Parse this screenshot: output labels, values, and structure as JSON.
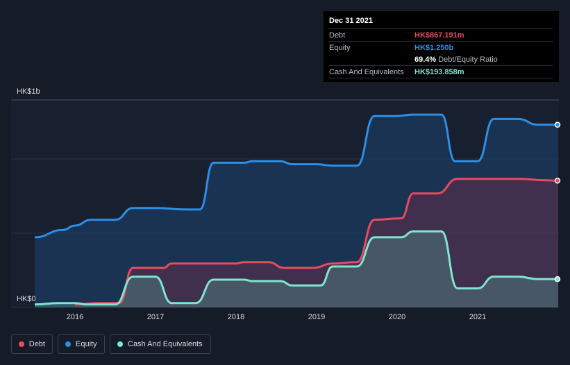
{
  "chart_data": {
    "type": "area",
    "y_axis": {
      "top_label": "HK$1b",
      "bottom_label": "HK$0",
      "ylim": [
        0,
        1.42
      ]
    },
    "x_ticks": [
      "2016",
      "2017",
      "2018",
      "2019",
      "2020",
      "2021"
    ],
    "series": [
      {
        "name": "Debt",
        "color": "#e84a5f",
        "points": [
          [
            2016.0,
            0.02
          ],
          [
            2016.3,
            0.03
          ],
          [
            2016.55,
            0.03
          ],
          [
            2016.72,
            0.27
          ],
          [
            2017.1,
            0.27
          ],
          [
            2017.2,
            0.3
          ],
          [
            2017.6,
            0.3
          ],
          [
            2018.0,
            0.3
          ],
          [
            2018.1,
            0.31
          ],
          [
            2018.4,
            0.31
          ],
          [
            2018.6,
            0.27
          ],
          [
            2018.95,
            0.27
          ],
          [
            2019.2,
            0.3
          ],
          [
            2019.5,
            0.31
          ],
          [
            2019.72,
            0.6
          ],
          [
            2020.05,
            0.61
          ],
          [
            2020.2,
            0.78
          ],
          [
            2020.5,
            0.78
          ],
          [
            2020.75,
            0.88
          ],
          [
            2021.2,
            0.88
          ],
          [
            2021.5,
            0.88
          ],
          [
            2021.85,
            0.87
          ],
          [
            2022.0,
            0.867
          ]
        ]
      },
      {
        "name": "Equity",
        "color": "#2d8ee6",
        "points": [
          [
            2015.5,
            0.48
          ],
          [
            2015.85,
            0.53
          ],
          [
            2016.0,
            0.56
          ],
          [
            2016.2,
            0.6
          ],
          [
            2016.5,
            0.6
          ],
          [
            2016.72,
            0.68
          ],
          [
            2017.0,
            0.68
          ],
          [
            2017.4,
            0.67
          ],
          [
            2017.55,
            0.67
          ],
          [
            2017.72,
            0.99
          ],
          [
            2018.1,
            0.99
          ],
          [
            2018.2,
            1.0
          ],
          [
            2018.55,
            1.0
          ],
          [
            2018.7,
            0.98
          ],
          [
            2019.0,
            0.98
          ],
          [
            2019.2,
            0.97
          ],
          [
            2019.5,
            0.97
          ],
          [
            2019.72,
            1.31
          ],
          [
            2020.0,
            1.31
          ],
          [
            2020.2,
            1.32
          ],
          [
            2020.55,
            1.32
          ],
          [
            2020.72,
            1.0
          ],
          [
            2021.0,
            1.0
          ],
          [
            2021.2,
            1.29
          ],
          [
            2021.5,
            1.29
          ],
          [
            2021.75,
            1.25
          ],
          [
            2022.0,
            1.25
          ]
        ]
      },
      {
        "name": "Cash And Equivalents",
        "color": "#7ee5d0",
        "points": [
          [
            2015.5,
            0.02
          ],
          [
            2015.8,
            0.03
          ],
          [
            2016.0,
            0.03
          ],
          [
            2016.15,
            0.02
          ],
          [
            2016.5,
            0.02
          ],
          [
            2016.72,
            0.21
          ],
          [
            2017.0,
            0.21
          ],
          [
            2017.2,
            0.03
          ],
          [
            2017.5,
            0.03
          ],
          [
            2017.72,
            0.19
          ],
          [
            2018.1,
            0.19
          ],
          [
            2018.2,
            0.18
          ],
          [
            2018.55,
            0.18
          ],
          [
            2018.7,
            0.15
          ],
          [
            2019.05,
            0.15
          ],
          [
            2019.2,
            0.28
          ],
          [
            2019.5,
            0.28
          ],
          [
            2019.72,
            0.48
          ],
          [
            2020.05,
            0.48
          ],
          [
            2020.2,
            0.52
          ],
          [
            2020.55,
            0.52
          ],
          [
            2020.75,
            0.13
          ],
          [
            2021.0,
            0.13
          ],
          [
            2021.2,
            0.21
          ],
          [
            2021.5,
            0.21
          ],
          [
            2021.75,
            0.194
          ],
          [
            2022.0,
            0.194
          ]
        ]
      }
    ]
  },
  "tooltip": {
    "date": "Dec 31 2021",
    "debt_label": "Debt",
    "debt_value": "HK$867.191m",
    "equity_label": "Equity",
    "equity_value": "HK$1.250b",
    "ratio_value": "69.4%",
    "ratio_text": "Debt/Equity Ratio",
    "cash_label": "Cash And Equivalents",
    "cash_value": "HK$193.858m"
  },
  "legend": [
    {
      "label": "Debt",
      "color": "#e84a5f"
    },
    {
      "label": "Equity",
      "color": "#2d8ee6"
    },
    {
      "label": "Cash And Equivalents",
      "color": "#7ee5d0"
    }
  ]
}
